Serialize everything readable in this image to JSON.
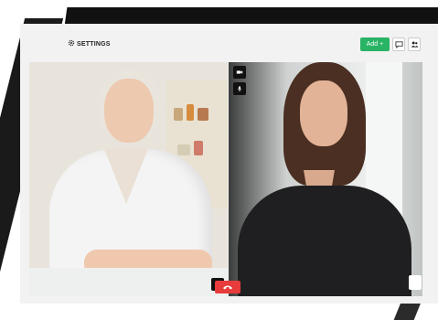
{
  "toolbar": {
    "settings_label": "SETTINGS",
    "settings_icon": "gear-icon",
    "add_label": "Add +",
    "chat_icon": "chat-bubble-icon",
    "participants_icon": "participants-icon"
  },
  "call": {
    "left_participant": {
      "expand_icon": "expand-icon"
    },
    "right_participant": {
      "camera_icon": "video-camera-icon",
      "mic_icon": "microphone-icon"
    },
    "hangup_icon": "hang-up-phone-icon"
  },
  "colors": {
    "add_button": "#29b365",
    "hangup_button": "#e83b3b",
    "toolbar_bg": "#f2f2f2"
  }
}
